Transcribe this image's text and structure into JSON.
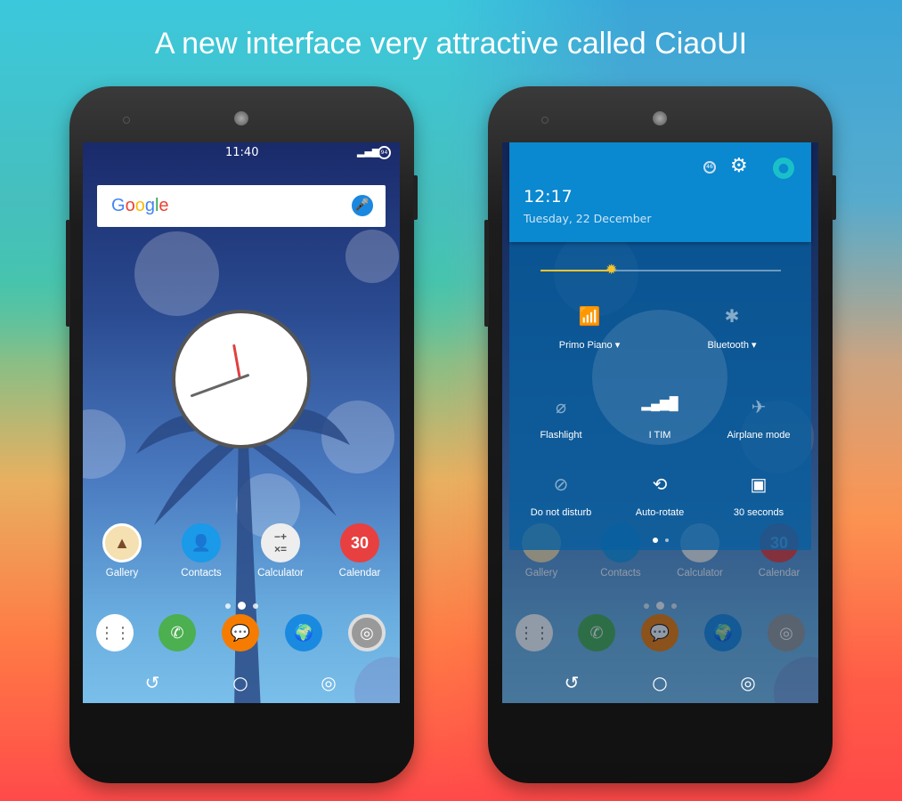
{
  "headline": "A new interface very attractive called CiaoUI",
  "colors": {
    "accent": "#0a88d0",
    "brightness": "#f4c430"
  },
  "home": {
    "status": {
      "time": "11:40",
      "battery": "94"
    },
    "search": {
      "logo": "Google",
      "icon": "mic-icon"
    },
    "apps": [
      {
        "label": "Gallery",
        "icon": "gallery-icon"
      },
      {
        "label": "Contacts",
        "icon": "contacts-icon"
      },
      {
        "label": "Calculator",
        "icon": "calculator-icon"
      },
      {
        "label": "Calendar",
        "icon": "calendar-icon",
        "badge": "30"
      }
    ],
    "dock": [
      "app-drawer-icon",
      "phone-icon",
      "messaging-icon",
      "browser-icon",
      "camera-icon"
    ],
    "page_count": 3,
    "current_page": 2
  },
  "quick_settings": {
    "time": "12:17",
    "date": "Tuesday, 22 December",
    "battery": "46",
    "brightness_percent": 30,
    "tiles": [
      {
        "label": "Primo Piano",
        "icon": "wifi-icon",
        "dropdown": true,
        "active": true
      },
      {
        "label": "Bluetooth",
        "icon": "bluetooth-off-icon",
        "dropdown": true,
        "active": false
      },
      {
        "label": "Flashlight",
        "icon": "flashlight-off-icon",
        "active": false
      },
      {
        "label": "I TIM",
        "icon": "signal-icon",
        "active": true
      },
      {
        "label": "Airplane mode",
        "icon": "airplane-icon",
        "active": false
      },
      {
        "label": "Do not disturb",
        "icon": "dnd-off-icon",
        "active": false
      },
      {
        "label": "Auto-rotate",
        "icon": "rotate-icon",
        "active": true
      },
      {
        "label": "30 seconds",
        "icon": "screen-timeout-icon",
        "active": true
      }
    ],
    "page_count": 2,
    "current_page": 1
  }
}
